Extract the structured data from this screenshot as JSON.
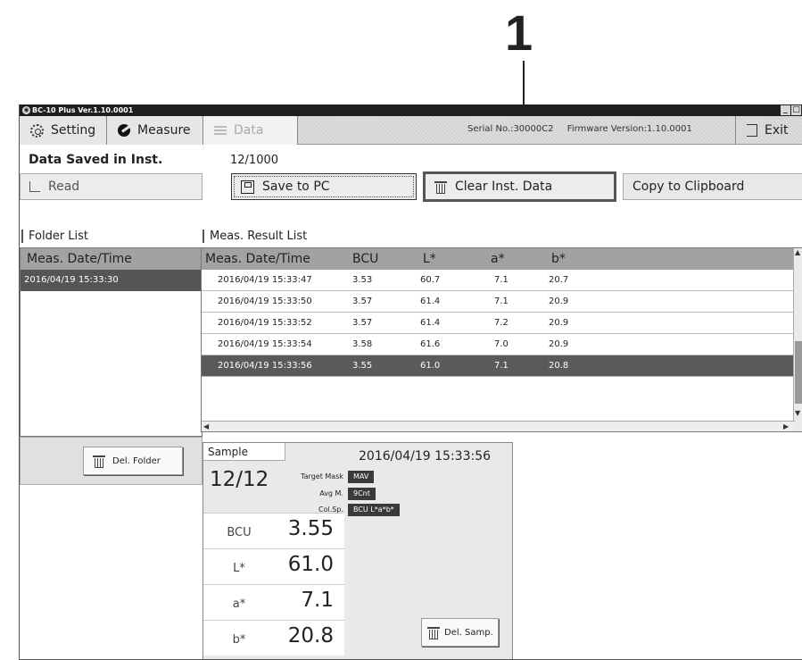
{
  "annotation": {
    "callout_number": "1"
  },
  "window": {
    "title": "BC-10 Plus Ver.1.10.0001",
    "controls": {
      "minimize": "_",
      "maximize": "□"
    }
  },
  "toolbar": {
    "tabs": [
      {
        "label": "Setting",
        "icon": "gear-icon",
        "state": "normal"
      },
      {
        "label": "Measure",
        "icon": "measure-icon",
        "state": "normal"
      },
      {
        "label": "Data",
        "icon": "list-icon",
        "state": "disabled"
      }
    ],
    "serial_text": "Serial No.:30000C2",
    "firmware_text": "Firmware Version:1.10.0001",
    "exit_label": "Exit"
  },
  "saved": {
    "label": "Data Saved in Inst.",
    "count": "12/1000"
  },
  "buttons": {
    "read": "Read",
    "save_pc": "Save to PC",
    "clear": "Clear Inst. Data",
    "copy": "Copy to Clipboard"
  },
  "folder_list": {
    "label": "Folder List",
    "header": "Meas. Date/Time",
    "rows": [
      "2016/04/19 15:33:30"
    ],
    "selected_index": 0,
    "del_button": "Del. Folder"
  },
  "result_list": {
    "label": "Meas. Result List",
    "columns": [
      "Meas. Date/Time",
      "BCU",
      "L*",
      "a*",
      "b*"
    ],
    "rows": [
      [
        "2016/04/19 15:33:47",
        "3.53",
        "60.7",
        "7.1",
        "20.7"
      ],
      [
        "2016/04/19 15:33:50",
        "3.57",
        "61.4",
        "7.1",
        "20.9"
      ],
      [
        "2016/04/19 15:33:52",
        "3.57",
        "61.4",
        "7.2",
        "20.9"
      ],
      [
        "2016/04/19 15:33:54",
        "3.58",
        "61.6",
        "7.0",
        "20.9"
      ],
      [
        "2016/04/19 15:33:56",
        "3.55",
        "61.0",
        "7.1",
        "20.8"
      ]
    ],
    "selected_index": 4
  },
  "sample": {
    "tab_label": "Sample",
    "datetime": "2016/04/19 15:33:56",
    "count": "12/12",
    "measurements": [
      {
        "label": "BCU",
        "value": "3.55"
      },
      {
        "label": "L*",
        "value": "61.0"
      },
      {
        "label": "a*",
        "value": "7.1"
      },
      {
        "label": "b*",
        "value": "20.8"
      }
    ],
    "target_mask_label": "Target Mask",
    "target_mask_value": "MAV",
    "avg_label": "Avg M.",
    "avg_value": "9Cnt",
    "colsp_label": "Col.Sp.",
    "colsp_value": "BCU L*a*b*",
    "del_button": "Del. Samp."
  }
}
